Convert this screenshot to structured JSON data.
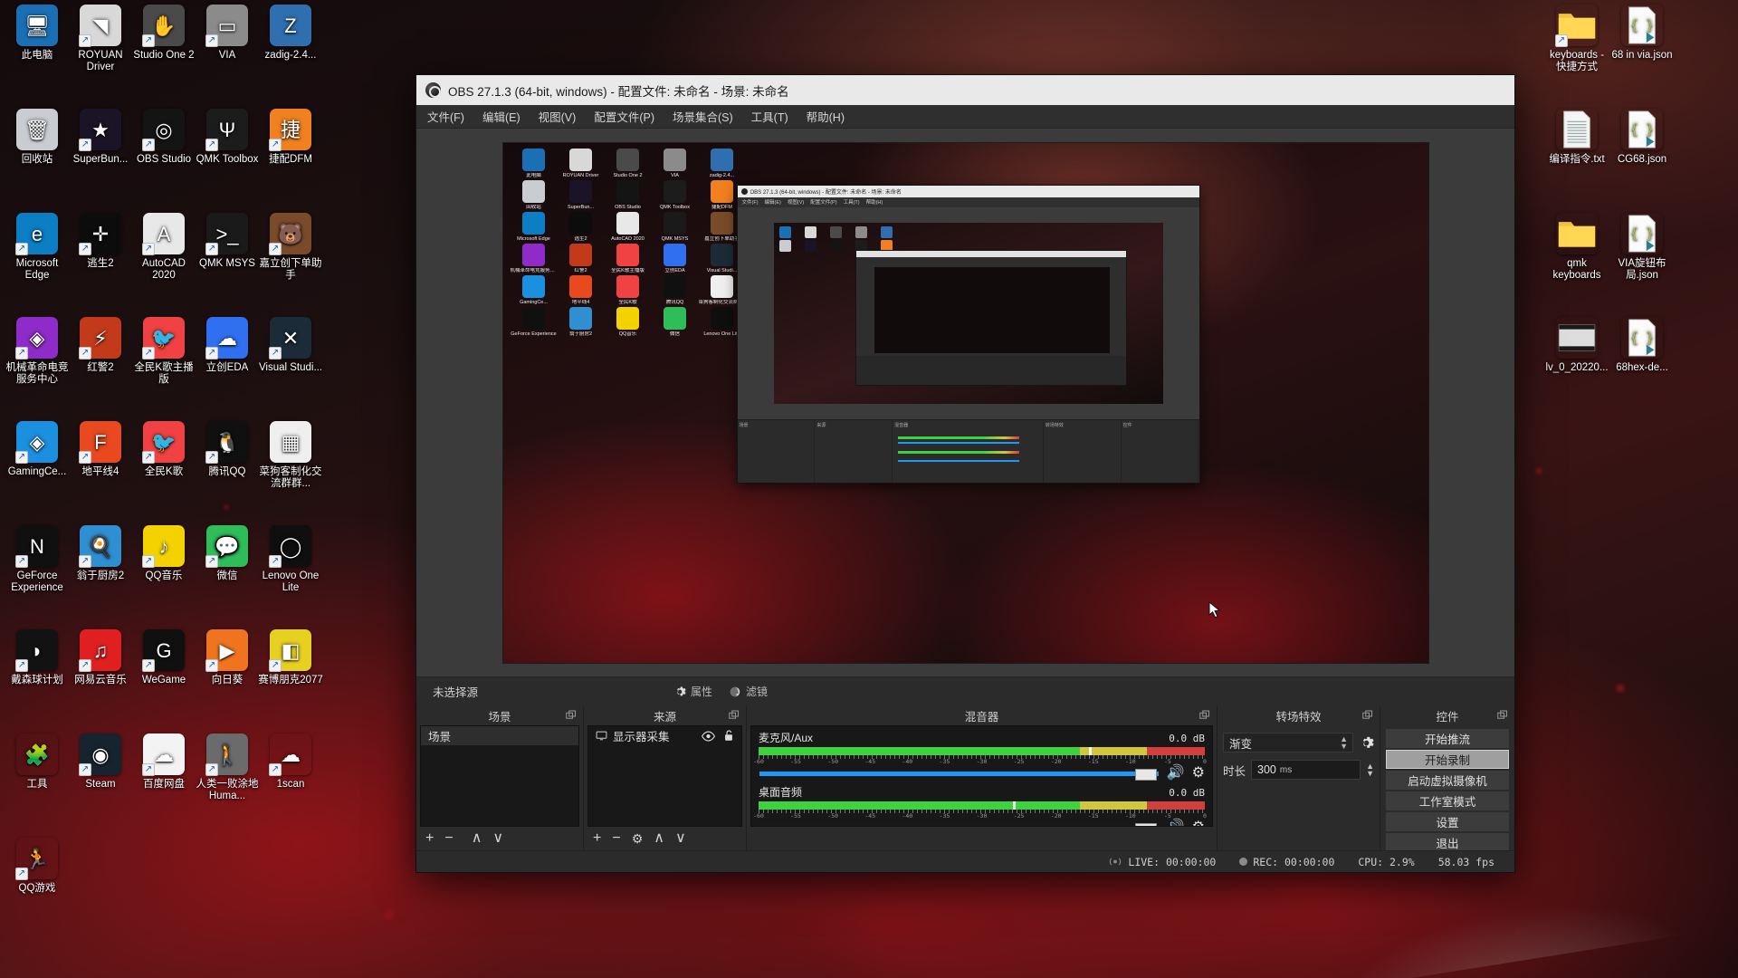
{
  "desktop": {
    "left_icons": [
      {
        "label": "此电脑",
        "icon": "this-pc-icon",
        "color": "#1a6fb5",
        "glyph": "🖥",
        "shortcut": false
      },
      {
        "label": "ROYUAN Driver",
        "icon": "royuan-driver-icon",
        "color": "#d8d8d8",
        "glyph": "◥",
        "shortcut": true
      },
      {
        "label": "Studio One 2",
        "icon": "studio-one-icon",
        "color": "#4a4a4a",
        "glyph": "✋",
        "shortcut": true
      },
      {
        "label": "VIA",
        "icon": "via-icon",
        "color": "#8b8b8b",
        "glyph": "▭",
        "shortcut": true
      },
      {
        "label": "zadig-2.4...",
        "icon": "zadig-icon",
        "color": "#2f6fb0",
        "glyph": "Z",
        "shortcut": false
      },
      {
        "label": "回收站",
        "icon": "recycle-bin-icon",
        "color": "#c9cdd2",
        "glyph": "🗑",
        "shortcut": false
      },
      {
        "label": "SuperBun...",
        "icon": "superbunnyman-icon",
        "color": "#1a1426",
        "glyph": "★",
        "shortcut": true
      },
      {
        "label": "OBS Studio",
        "icon": "obs-studio-icon",
        "color": "#141414",
        "glyph": "◎",
        "shortcut": true
      },
      {
        "label": "QMK Toolbox",
        "icon": "qmk-toolbox-icon",
        "color": "#1c1c1c",
        "glyph": "Ψ",
        "shortcut": true
      },
      {
        "label": "捷配DFM",
        "icon": "jiepei-dfm-icon",
        "color": "#f08020",
        "glyph": "捷",
        "shortcut": true
      },
      {
        "label": "Microsoft Edge",
        "icon": "microsoft-edge-icon",
        "color": "#0b7ec4",
        "glyph": "e",
        "shortcut": true
      },
      {
        "label": "逃生2",
        "icon": "outlast2-icon",
        "color": "#0c0c0c",
        "glyph": "✛",
        "shortcut": true
      },
      {
        "label": "AutoCAD 2020",
        "icon": "autocad-icon",
        "color": "#e8e8e8",
        "glyph": "A",
        "shortcut": true
      },
      {
        "label": "QMK MSYS",
        "icon": "qmk-msys-icon",
        "color": "#1a1a1a",
        "glyph": ">_",
        "shortcut": true
      },
      {
        "label": "嘉立创下单助手",
        "icon": "jlc-order-helper-icon",
        "color": "#7a4b2a",
        "glyph": "🐻",
        "shortcut": true
      },
      {
        "label": "机械革命电竞服务中心",
        "icon": "mechrevo-center-icon",
        "color": "#8e2bc9",
        "glyph": "◈",
        "shortcut": true
      },
      {
        "label": "红警2",
        "icon": "red-alert-2-icon",
        "color": "#c23a1a",
        "glyph": "⚡",
        "shortcut": true
      },
      {
        "label": "全民K歌主播版",
        "icon": "kge-anchor-icon",
        "color": "#f04242",
        "glyph": "🐦",
        "shortcut": true
      },
      {
        "label": "立创EDA",
        "icon": "lceda-icon",
        "color": "#2f6ff0",
        "glyph": "☁",
        "shortcut": true
      },
      {
        "label": "Visual Studi...",
        "icon": "visual-studio-code-icon",
        "color": "#1c2b38",
        "glyph": "✕",
        "shortcut": true
      },
      {
        "label": "GamingCe...",
        "icon": "gaming-center-icon",
        "color": "#1b8fe0",
        "glyph": "◈",
        "shortcut": true
      },
      {
        "label": "地平线4",
        "icon": "forza-horizon-4-icon",
        "color": "#e8491f",
        "glyph": "F",
        "shortcut": true
      },
      {
        "label": "全民K歌",
        "icon": "quanmin-kge-icon",
        "color": "#f04242",
        "glyph": "🐦",
        "shortcut": true
      },
      {
        "label": "腾讯QQ",
        "icon": "tencent-qq-icon",
        "color": "#101010",
        "glyph": "🐧",
        "shortcut": true
      },
      {
        "label": "菜狗客制化交流群群...",
        "icon": "qr-code-icon",
        "color": "#efefef",
        "glyph": "▦",
        "shortcut": false
      },
      {
        "label": "GeForce Experience",
        "icon": "geforce-experience-icon",
        "color": "#101010",
        "glyph": "N",
        "shortcut": true
      },
      {
        "label": "翁于厨房2",
        "icon": "overcooked-2-icon",
        "color": "#2f8fd0",
        "glyph": "🍳",
        "shortcut": true
      },
      {
        "label": "QQ音乐",
        "icon": "qq-music-icon",
        "color": "#f3d200",
        "glyph": "♪",
        "shortcut": true
      },
      {
        "label": "微信",
        "icon": "wechat-icon",
        "color": "#2fbd5a",
        "glyph": "💬",
        "shortcut": true
      },
      {
        "label": "Lenovo One Lite",
        "icon": "lenovo-one-lite-icon",
        "color": "#0f0f0f",
        "glyph": "◯",
        "shortcut": true
      },
      {
        "label": "戴森球计划",
        "icon": "dyson-sphere-program-icon",
        "color": "#121212",
        "glyph": "◗",
        "shortcut": true
      },
      {
        "label": "网易云音乐",
        "icon": "netease-music-icon",
        "color": "#e02020",
        "glyph": "♫",
        "shortcut": true
      },
      {
        "label": "WeGame",
        "icon": "wegame-icon",
        "color": "#101010",
        "glyph": "G",
        "shortcut": true
      },
      {
        "label": "向日葵",
        "icon": "sunlogin-icon",
        "color": "#f07420",
        "glyph": "▶",
        "shortcut": true
      },
      {
        "label": "赛博朋克2077",
        "icon": "cyberpunk-2077-icon",
        "color": "#e8d020",
        "glyph": "◧",
        "shortcut": true
      },
      {
        "label": "工具",
        "icon": "tools-folder-icon",
        "color": "#0000",
        "glyph": "🧩",
        "shortcut": false
      },
      {
        "label": "Steam",
        "icon": "steam-icon",
        "color": "#17232f",
        "glyph": "◉",
        "shortcut": true
      },
      {
        "label": "百度网盘",
        "icon": "baidu-netdisk-icon",
        "color": "#f3f3f3",
        "glyph": "☁",
        "shortcut": true
      },
      {
        "label": "人类一败涂地 Huma...",
        "icon": "human-fall-flat-icon",
        "color": "#6b6b6b",
        "glyph": "🚶",
        "shortcut": true
      },
      {
        "label": "1scan",
        "icon": "onescan-icon",
        "color": "#0000",
        "glyph": "☁",
        "shortcut": true
      },
      {
        "label": "QQ游戏",
        "icon": "qq-game-icon",
        "color": "#0000",
        "glyph": "🏃",
        "shortcut": true
      }
    ],
    "right_icons": [
      {
        "label": "keyboards - 快捷方式",
        "icon": "folder-icon",
        "type": "folder",
        "shortcut": true
      },
      {
        "label": "68 in via.json",
        "icon": "json-file-icon",
        "type": "json",
        "shortcut": false
      },
      {
        "label": "编译指令.txt",
        "icon": "text-file-icon",
        "type": "txt",
        "shortcut": false
      },
      {
        "label": "CG68.json",
        "icon": "json-file-icon",
        "type": "json",
        "shortcut": false
      },
      {
        "label": "qmk keyboards",
        "icon": "folder-icon",
        "type": "folder",
        "shortcut": false
      },
      {
        "label": "VIA旋钮布局.json",
        "icon": "json-file-icon",
        "type": "json",
        "shortcut": false
      },
      {
        "label": "lv_0_20220...",
        "icon": "video-file-icon",
        "type": "video",
        "shortcut": false
      },
      {
        "label": "68hex-de...",
        "icon": "json-file-icon",
        "type": "json",
        "shortcut": false
      }
    ]
  },
  "obs": {
    "title": "OBS 27.1.3 (64-bit, windows) - 配置文件: 未命名 - 场景: 未命名",
    "menu": [
      "文件(F)",
      "编辑(E)",
      "视图(V)",
      "配置文件(P)",
      "场景集合(S)",
      "工具(T)",
      "帮助(H)"
    ],
    "source_toolbar": {
      "status": "未选择源",
      "properties_label": "属性",
      "filters_label": "滤镜"
    },
    "scenes": {
      "title": "场景",
      "items": [
        "场景"
      ],
      "footer": [
        "+",
        "−",
        "∧",
        "∨"
      ]
    },
    "sources": {
      "title": "来源",
      "items": [
        {
          "name": "显示器采集",
          "visible": true,
          "locked": false
        }
      ],
      "footer": [
        "+",
        "−",
        "⚙",
        "∧",
        "∨"
      ]
    },
    "mixer": {
      "title": "混音器",
      "tracks": [
        {
          "name": "麦克风/Aux",
          "db": "0.0",
          "unit": "dB",
          "level_pct": 74,
          "volume_pct": 97
        },
        {
          "name": "桌面音频",
          "db": "0.0",
          "unit": "dB",
          "level_pct": 57,
          "volume_pct": 97
        }
      ],
      "tick_labels": [
        "-60",
        "-55",
        "-50",
        "-45",
        "-40",
        "-35",
        "-30",
        "-25",
        "-20",
        "-15",
        "-10",
        "-5",
        "0"
      ]
    },
    "transitions": {
      "title": "转场特效",
      "selected": "渐变",
      "duration_label": "时长",
      "duration_value": "300",
      "duration_unit": "ms"
    },
    "controls": {
      "title": "控件",
      "buttons": [
        {
          "label": "开始推流",
          "hovered": false
        },
        {
          "label": "开始录制",
          "hovered": true
        },
        {
          "label": "启动虚拟摄像机",
          "hovered": false
        },
        {
          "label": "工作室模式",
          "hovered": false
        },
        {
          "label": "设置",
          "hovered": false
        },
        {
          "label": "退出",
          "hovered": false
        }
      ]
    },
    "statusbar": {
      "live_label": "LIVE:",
      "live_time": "00:00:00",
      "rec_label": "REC:",
      "rec_time": "00:00:00",
      "cpu": "CPU: 2.9%",
      "fps": "58.03 fps"
    },
    "preview": {
      "inner_title": "OBS 27.1.3 (64-bit, windows) - 配置文件: 未命名 - 场景: 未命名",
      "inner_menu": [
        "文件(F)",
        "编辑(E)",
        "视图(V)",
        "配置文件(P)",
        "工具(T)",
        "帮助(H)"
      ]
    }
  },
  "colors": {
    "obs_chrome": "#2b2b2b",
    "obs_panel": "#181818",
    "obs_titlebar": "#e9e9e9",
    "accent_blue": "#2196f3",
    "meter_green": "#3fd23f",
    "meter_yellow": "#d2c63f",
    "meter_red": "#d23f3f",
    "highlight": "#9f9f9f"
  }
}
